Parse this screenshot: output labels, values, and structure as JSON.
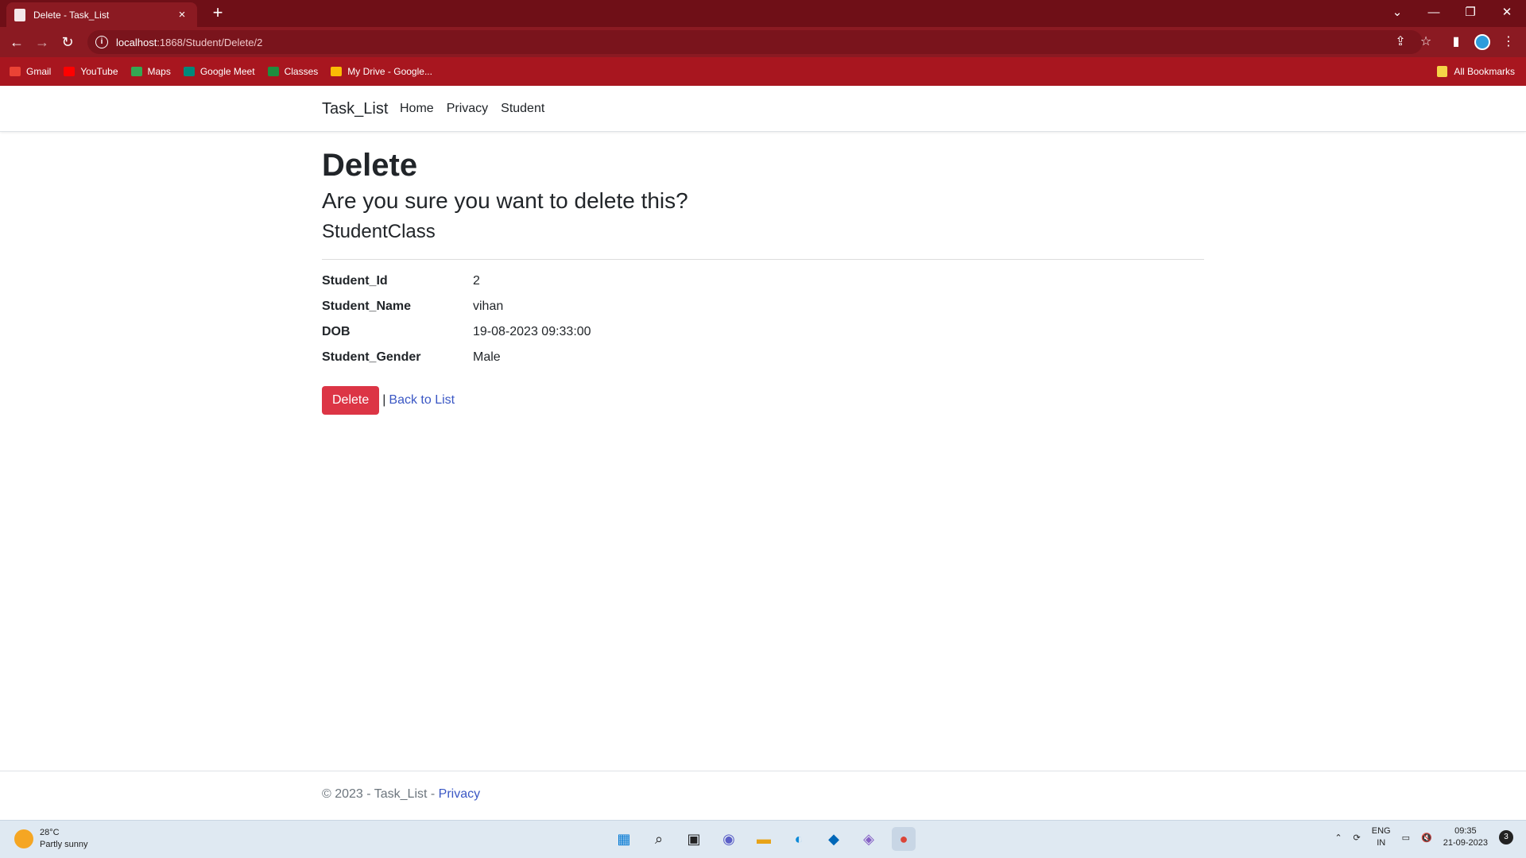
{
  "browser": {
    "tab_title": "Delete - Task_List",
    "tab_close": "×",
    "new_tab": "+",
    "url_host": "localhost",
    "url_path": ":1868/Student/Delete/2",
    "window_controls": {
      "dropdown": "⌄",
      "minimize": "—",
      "restore": "❐",
      "close": "✕"
    },
    "bookmarks": [
      {
        "label": "Gmail",
        "color": "#ea4335"
      },
      {
        "label": "YouTube",
        "color": "#ff0000"
      },
      {
        "label": "Maps",
        "color": "#34a853"
      },
      {
        "label": "Google Meet",
        "color": "#00897b"
      },
      {
        "label": "Classes",
        "color": "#1e8e3e"
      },
      {
        "label": "My Drive - Google...",
        "color": "#fbbc04"
      }
    ],
    "all_bookmarks": "All Bookmarks"
  },
  "navbar": {
    "brand": "Task_List",
    "links": [
      "Home",
      "Privacy",
      "Student"
    ]
  },
  "main": {
    "heading": "Delete",
    "confirm": "Are you sure you want to delete this?",
    "entity": "StudentClass",
    "fields": [
      {
        "label": "Student_Id",
        "value": "2"
      },
      {
        "label": "Student_Name",
        "value": "vihan"
      },
      {
        "label": "DOB",
        "value": "19-08-2023 09:33:00"
      },
      {
        "label": "Student_Gender",
        "value": "Male"
      }
    ],
    "delete_button": "Delete",
    "separator": "|",
    "back_link": "Back to List"
  },
  "footer": {
    "text": "© 2023 - Task_List - ",
    "privacy": "Privacy"
  },
  "taskbar": {
    "temperature": "28°C",
    "weather": "Partly sunny",
    "lang_top": "ENG",
    "lang_bottom": "IN",
    "time": "09:35",
    "date": "21-09-2023",
    "notifications": "3"
  },
  "colors": {
    "delete_button": "#dc3545",
    "link": "#3a57c4",
    "chrome_tabstrip": "#6f0f17",
    "chrome_toolbar": "#8b1a22",
    "bookmarks_bar": "#a8161f"
  }
}
